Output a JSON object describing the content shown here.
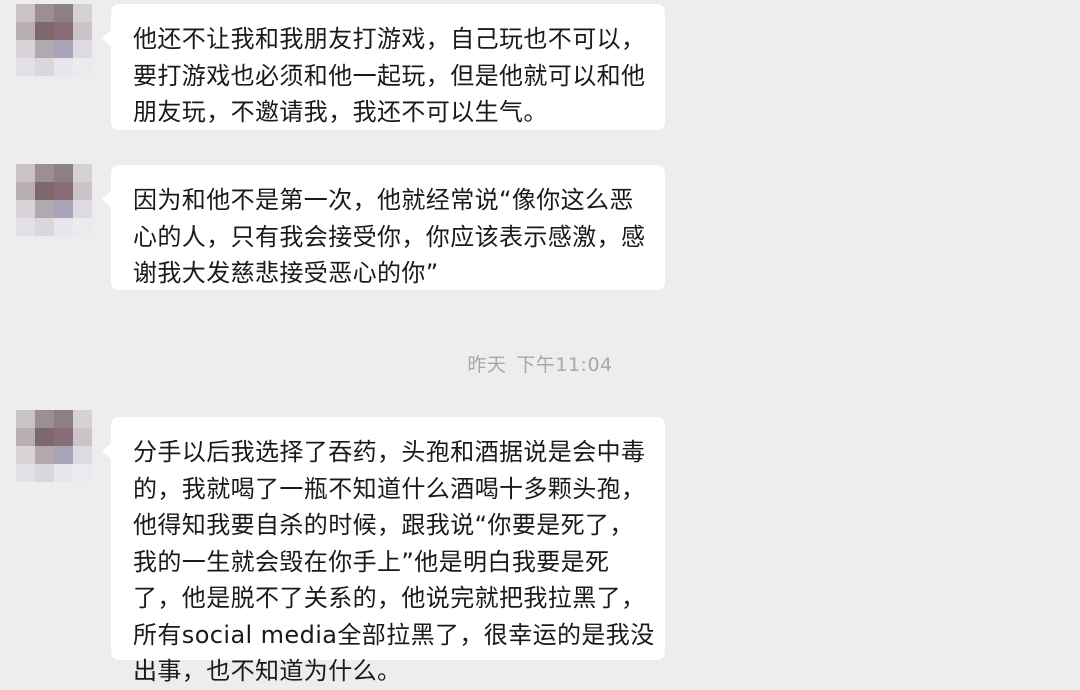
{
  "messages": [
    {
      "lines": [
        "他还不让我和我朋友打游戏，自己玩也不可以，",
        "要打游戏也必须和他一起玩，但是他就可以和他",
        "朋友玩，不邀请我，我还不可以生气。"
      ]
    },
    {
      "lines": [
        "因为和他不是第一次，他就经常说“像你这么恶",
        "心的人，只有我会接受你，你应该表示感激，感",
        "谢我大发慈悲接受恶心的你”"
      ]
    },
    {
      "lines": [
        "分手以后我选择了吞药，头孢和酒据说是会中毒",
        "的，我就喝了一瓶不知道什么酒喝十多颗头孢，",
        "他得知我要自杀的时候，跟我说“你要是死了，",
        "我的一生就会毁在你手上”他是明白我要是死",
        "了，他是脱不了关系的，他说完就把我拉黑了，",
        "所有social media全部拉黑了，很幸运的是我没",
        "出事，也不知道为什么。"
      ]
    }
  ],
  "timestamp": {
    "day": "昨天",
    "time": "下午11:04"
  },
  "colors": {
    "background": "#ededed",
    "bubble": "#ffffff",
    "text": "#1a1a1a",
    "timestamp": "#a8a8a8"
  },
  "avatar_icon": "pixelated-avatar-icon"
}
